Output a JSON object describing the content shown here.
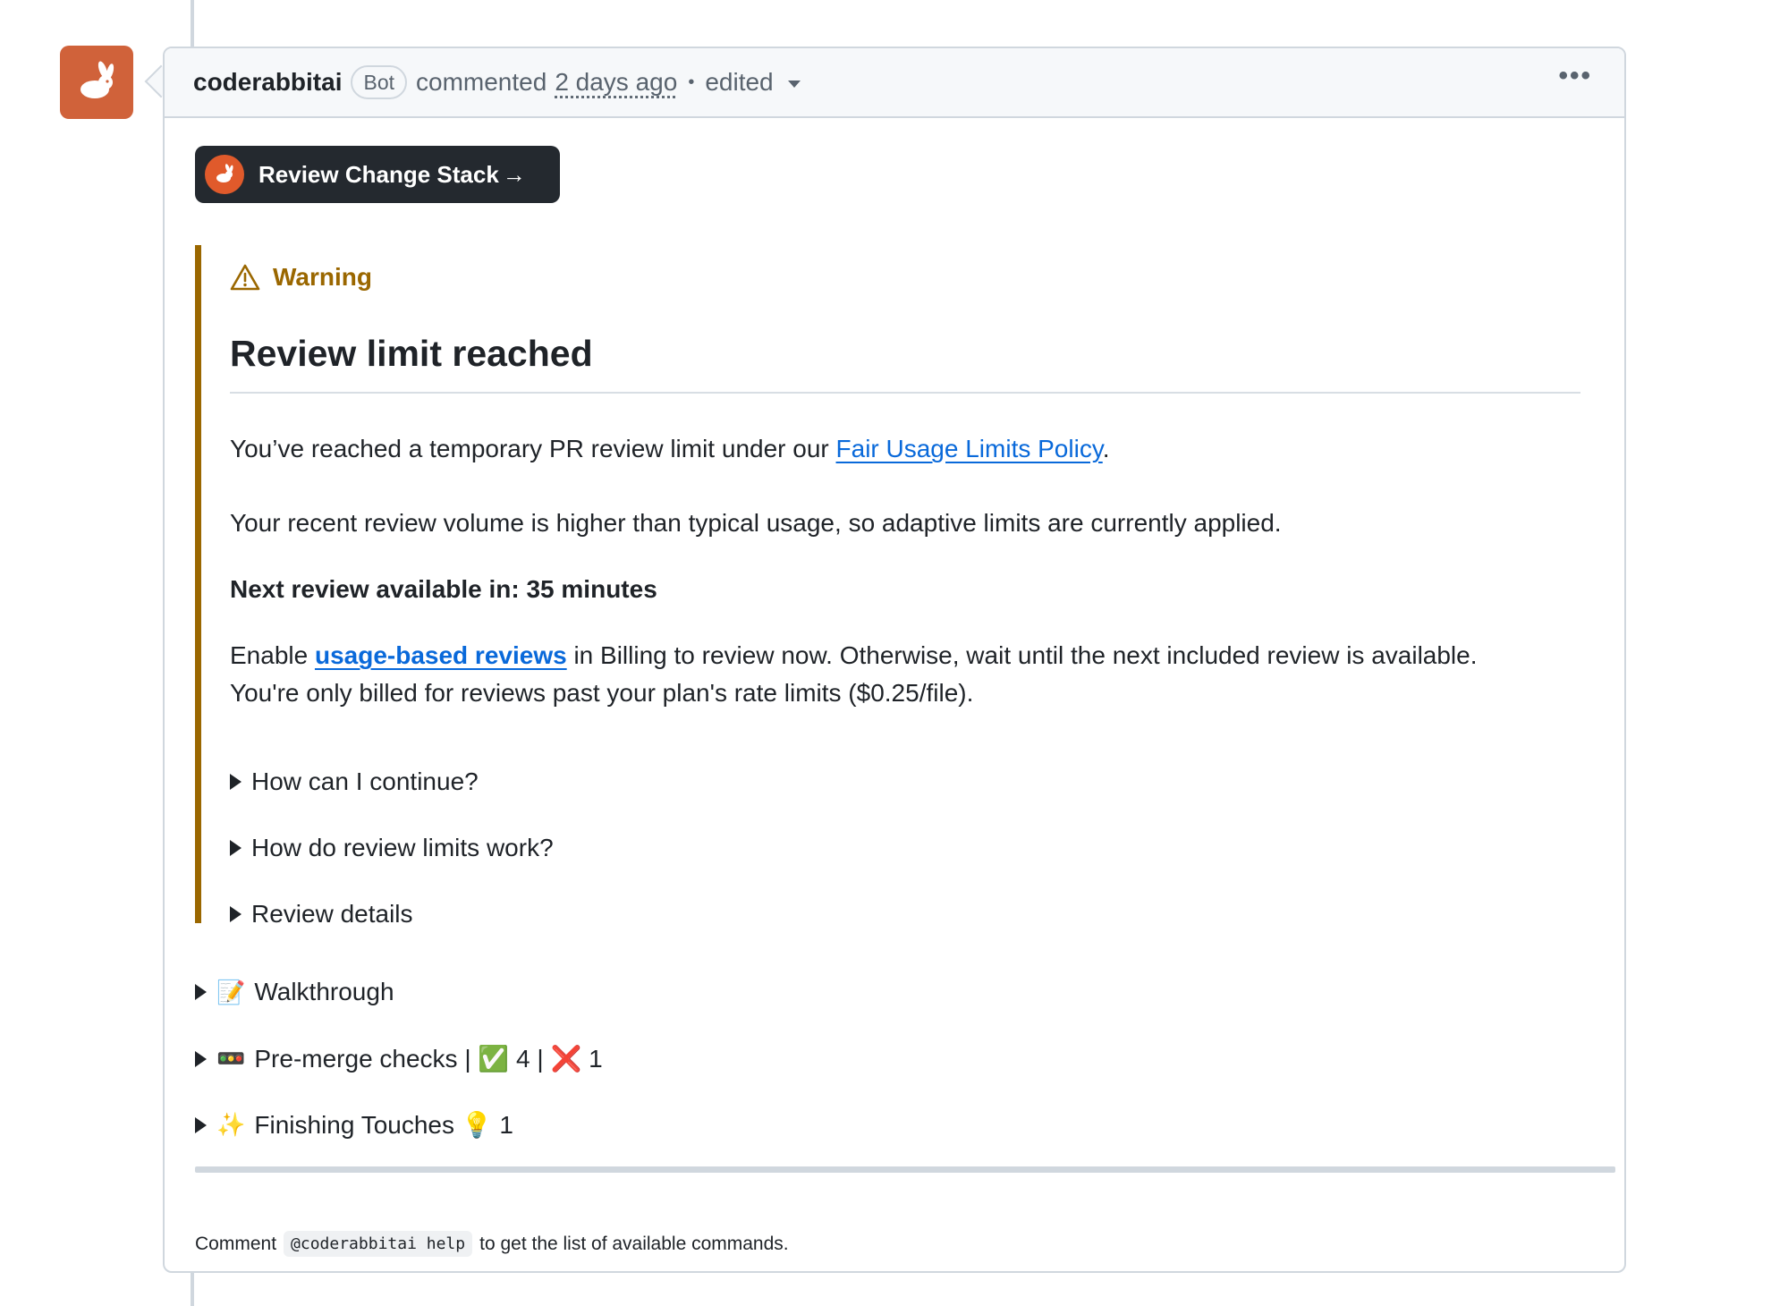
{
  "comment": {
    "author": "coderabbitai",
    "badge": "Bot",
    "action": "commented",
    "time": "2 days ago",
    "separator": "•",
    "edited": "edited",
    "more_label": "•••"
  },
  "stack_button": {
    "label": "Review Change Stack",
    "arrow": "→"
  },
  "warning": {
    "label": "Warning",
    "heading": "Review limit reached",
    "p1_text": "You’ve reached a temporary PR review limit under our ",
    "p1_link": "Fair Usage Limits Policy",
    "p1_end": ".",
    "p2": "Your recent review volume is higher than typical usage, so adaptive limits are currently applied.",
    "p3": "Next review available in: 35 minutes",
    "p4_start": "Enable ",
    "p4_link": "usage-based reviews",
    "p4_end": " in Billing to review now. Otherwise, wait until the next included review is available.",
    "p5": "You're only billed for reviews past your plan's rate limits ($0.25/file).",
    "details": [
      "How can I continue?",
      "How do review limits work?",
      "Review details"
    ]
  },
  "sections": {
    "walkthrough": {
      "emoji": "📝",
      "label": "Walkthrough"
    },
    "premerge": {
      "emoji": "🚥",
      "label": "Pre-merge checks | ",
      "pass_emoji": "✅",
      "pass_count": " 4 | ",
      "fail_emoji": "❌",
      "fail_count": " 1"
    },
    "finishing": {
      "emoji": "✨",
      "label": "Finishing Touches ",
      "hint_emoji": "💡",
      "hint_count": " 1"
    }
  },
  "footer": {
    "before": "Comment",
    "command": "@coderabbitai help",
    "after": "to get the list of available commands."
  },
  "colors": {
    "brand": "#d0623a",
    "warning": "#9a6700",
    "link": "#0969da"
  }
}
